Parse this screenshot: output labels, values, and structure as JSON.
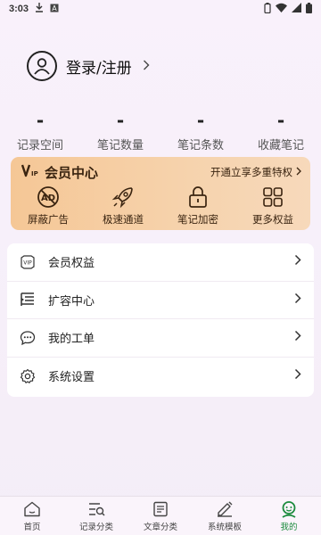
{
  "status_bar": {
    "time": "3:03"
  },
  "profile": {
    "login_label": "登录/注册"
  },
  "stats": [
    {
      "value": "-",
      "label": "记录空间"
    },
    {
      "value": "-",
      "label": "笔记数量"
    },
    {
      "value": "-",
      "label": "笔记条数"
    },
    {
      "value": "-",
      "label": "收藏笔记"
    }
  ],
  "vip": {
    "title": "会员中心",
    "promo": "开通立享多重特权",
    "features": [
      {
        "label": "屏蔽广告",
        "icon": "no-ads-icon"
      },
      {
        "label": "极速通道",
        "icon": "rocket-icon"
      },
      {
        "label": "笔记加密",
        "icon": "lock-icon"
      },
      {
        "label": "更多权益",
        "icon": "grid-icon"
      }
    ],
    "accent": "#f5c796"
  },
  "menu": [
    {
      "label": "会员权益",
      "icon": "vip-icon"
    },
    {
      "label": "扩容中心",
      "icon": "expand-icon"
    },
    {
      "label": "我的工单",
      "icon": "chat-icon"
    },
    {
      "label": "系统设置",
      "icon": "gear-icon"
    }
  ],
  "bottom_nav": [
    {
      "label": "首页",
      "icon": "home-icon"
    },
    {
      "label": "记录分类",
      "icon": "category-icon"
    },
    {
      "label": "文章分类",
      "icon": "article-icon"
    },
    {
      "label": "系统模板",
      "icon": "template-icon"
    },
    {
      "label": "我的",
      "icon": "mine-icon",
      "active": true
    }
  ],
  "colors": {
    "active": "#1a8a3c"
  }
}
